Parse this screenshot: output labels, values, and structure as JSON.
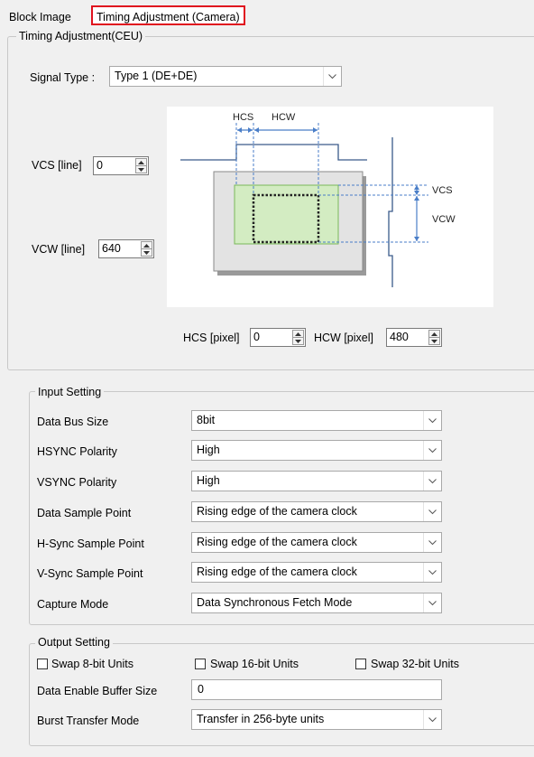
{
  "tabs": {
    "block_image": "Block Image",
    "timing_adjustment": "Timing Adjustment (Camera)"
  },
  "ceu_group": {
    "title": "Timing Adjustment(CEU)",
    "signal_type": {
      "label": "Signal Type :",
      "value": "Type 1 (DE+DE)"
    },
    "vcs": {
      "label": "VCS [line]",
      "value": "0"
    },
    "vcw": {
      "label": "VCW [line]",
      "value": "640"
    },
    "hcs": {
      "label": "HCS [pixel]",
      "value": "0"
    },
    "hcw": {
      "label": "HCW [pixel]",
      "value": "480"
    },
    "diagram": {
      "hcs_label": "HCS",
      "hcw_label": "HCW",
      "vcs_label": "VCS",
      "vcw_label": "VCW",
      "colors": {
        "window_fill": "#d3ecc2",
        "window_border": "#7ab85a",
        "frame_fill": "#e3e3e3",
        "guides": "#4a7ec8"
      }
    }
  },
  "input_setting": {
    "title": "Input Setting",
    "rows": [
      {
        "label": "Data Bus Size",
        "value": "8bit"
      },
      {
        "label": "HSYNC Polarity",
        "value": "High"
      },
      {
        "label": "VSYNC Polarity",
        "value": "High"
      },
      {
        "label": "Data Sample Point",
        "value": "Rising edge of the camera clock"
      },
      {
        "label": "H-Sync Sample Point",
        "value": "Rising edge of the camera clock"
      },
      {
        "label": "V-Sync Sample Point",
        "value": "Rising edge of the camera clock"
      },
      {
        "label": "Capture Mode",
        "value": "Data Synchronous Fetch Mode"
      }
    ]
  },
  "output_setting": {
    "title": "Output Setting",
    "checkboxes": [
      {
        "label": "Swap 8-bit Units",
        "checked": false
      },
      {
        "label": "Swap 16-bit Units",
        "checked": false
      },
      {
        "label": "Swap 32-bit Units",
        "checked": false
      }
    ],
    "data_enable_buffer": {
      "label": "Data Enable Buffer Size",
      "value": "0"
    },
    "burst_transfer": {
      "label": "Burst Transfer Mode",
      "value": "Transfer in 256-byte units"
    }
  },
  "colors": {
    "highlight_border": "#e0111e",
    "panel_bg": "#f0f0f0"
  }
}
